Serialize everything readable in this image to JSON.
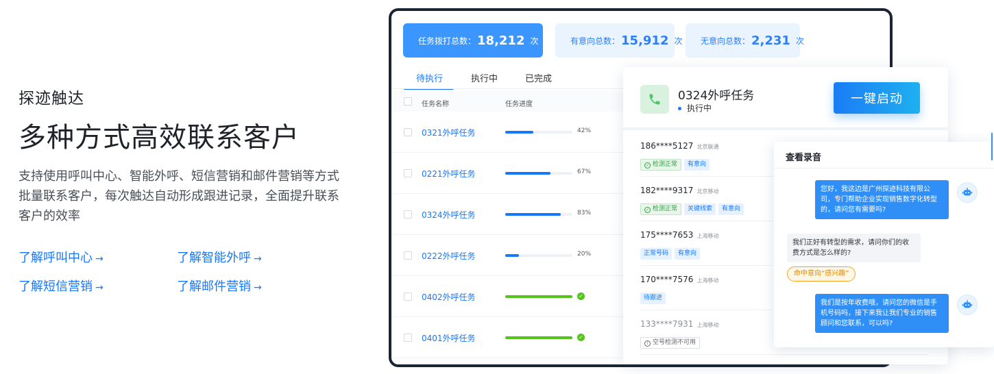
{
  "intro": {
    "eyebrow": "探迹触达",
    "headline": "多种方式高效联系客户",
    "description": "支持使用呼叫中心、智能外呼、短信营销和邮件营销等方式批量联系客户，每次触达自动形成跟进记录，全面提升联系客户的效率",
    "links": [
      {
        "label": "了解呼叫中心",
        "arrow": "→"
      },
      {
        "label": "了解智能外呼",
        "arrow": "→"
      },
      {
        "label": "了解短信营销",
        "arrow": "→"
      },
      {
        "label": "了解邮件营销",
        "arrow": "→"
      }
    ]
  },
  "dashboard": {
    "stats": [
      {
        "label": "任务拨打总数：",
        "value": "18,212",
        "unit": "次"
      },
      {
        "label": "有意向总数：",
        "value": "15,912",
        "unit": "次"
      },
      {
        "label": "无意向总数：",
        "value": "2,231",
        "unit": "次"
      }
    ],
    "tabs": [
      "待执行",
      "执行中",
      "已完成"
    ],
    "active_tab": "待执行",
    "columns": {
      "name": "任务名称",
      "progress": "任务进度"
    },
    "tasks": [
      {
        "name": "0321外呼任务",
        "progress": 42,
        "label": "42%"
      },
      {
        "name": "0221外呼任务",
        "progress": 67,
        "label": "67%"
      },
      {
        "name": "0324外呼任务",
        "progress": 83,
        "label": "83%"
      },
      {
        "name": "0222外呼任务",
        "progress": 20,
        "label": "20%"
      },
      {
        "name": "0402外呼任务",
        "progress": 100,
        "label": "",
        "done": true
      },
      {
        "name": "0401外呼任务",
        "progress": 100,
        "label": "",
        "done": true
      }
    ]
  },
  "task_card": {
    "title": "0324外呼任务",
    "status": "执行中",
    "start_label": "一键启动",
    "calls": [
      {
        "phone": "186****5127",
        "carrier": "北京联通",
        "tags": [
          {
            "text": "检测正常",
            "style": "green",
            "check": true
          },
          {
            "text": "有意向",
            "style": "blue"
          }
        ]
      },
      {
        "phone": "182****9317",
        "carrier": "北京移动",
        "tags": [
          {
            "text": "检测正常",
            "style": "green",
            "check": true
          },
          {
            "text": "关键线索",
            "style": "blue"
          },
          {
            "text": "有意向",
            "style": "blue"
          }
        ]
      },
      {
        "phone": "175****7653",
        "carrier": "上海移动",
        "tags": [
          {
            "text": "正常号码",
            "style": "blue"
          },
          {
            "text": "有意向",
            "style": "blue"
          }
        ]
      },
      {
        "phone": "170****7576",
        "carrier": "上海移动",
        "tags": [
          {
            "text": "待跟进",
            "style": "blue"
          }
        ]
      },
      {
        "phone": "133****7931",
        "carrier": "上海移动",
        "muted": true,
        "tags": [
          {
            "text": "空号检测不可用",
            "style": "grey",
            "info": true
          }
        ]
      }
    ]
  },
  "recording": {
    "title": "查看录音",
    "messages": [
      {
        "from": "bot",
        "text": "您好，我这边是广州探迹科技有限公司，专门帮助企业实现销售数字化转型的，请问您有需要吗?"
      },
      {
        "from": "customer",
        "text": "我们正好有转型的需求，请问你们的收费方式是怎么样的?"
      },
      {
        "from": "bot",
        "text": "我们是按年收费哦，请问您的微信是手机号码吗，接下来我让我们专业的销售顾问和您联系，可以吗?"
      }
    ],
    "intent_hit": "命中意向“感兴趣”"
  },
  "colors": {
    "accent": "#1677ff",
    "stat_primary": "#3b97ff",
    "stat_soft": "#eaf4ff",
    "done_green": "#52c41a",
    "frame": "#1b2433"
  }
}
